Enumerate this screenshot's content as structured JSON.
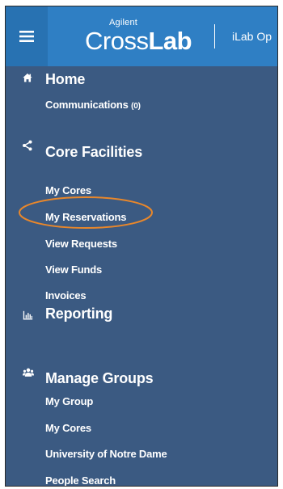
{
  "header": {
    "brand_small": "Agilent",
    "brand_light": "Cross",
    "brand_bold": "Lab",
    "app_title": "iLab Op"
  },
  "nav": {
    "home": {
      "label": "Home",
      "icon": "home-icon",
      "items": [
        {
          "label": "Communications",
          "count": "(0)"
        }
      ]
    },
    "core_facilities": {
      "label": "Core Facilities",
      "icon": "share-icon",
      "items": [
        {
          "label": "My Cores"
        },
        {
          "label": "My Reservations"
        },
        {
          "label": "View Requests"
        },
        {
          "label": "View Funds"
        },
        {
          "label": "Invoices"
        }
      ]
    },
    "reporting": {
      "label": "Reporting",
      "icon": "bar-chart-icon"
    },
    "manage_groups": {
      "label": "Manage Groups",
      "icon": "users-icon",
      "items": [
        {
          "label": "My Group"
        },
        {
          "label": "My Cores"
        },
        {
          "label": "University of Notre Dame"
        },
        {
          "label": "People Search"
        }
      ]
    }
  },
  "colors": {
    "topbar": "#2f7fc4",
    "hamburger_bg": "#2872b2",
    "sidebar": "#3b5a82",
    "highlight": "#e8872b",
    "text": "#ffffff"
  }
}
